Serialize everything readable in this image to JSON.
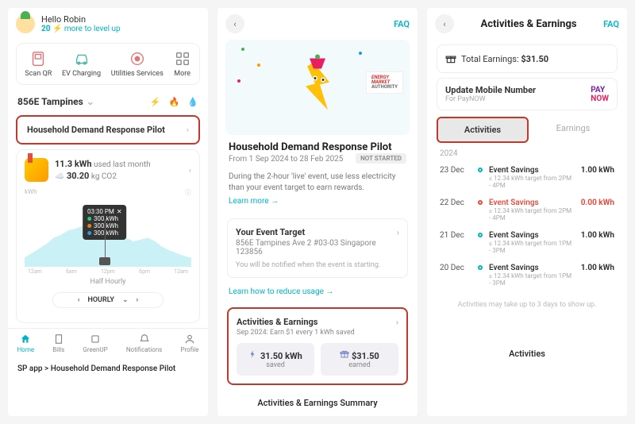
{
  "colors": {
    "accent": "#00b4c4",
    "highlight": "#c0392b"
  },
  "phone1": {
    "greeting_prefix": "Hello",
    "user_name": "Robin",
    "level_points": "20",
    "level_text": "more to level up",
    "quick": [
      {
        "id": "scan-qr",
        "label": "Scan QR"
      },
      {
        "id": "ev-charging",
        "label": "EV Charging"
      },
      {
        "id": "utilities",
        "label": "Utilities Services"
      },
      {
        "id": "more",
        "label": "More"
      }
    ],
    "address": "856E Tampines",
    "pilot_title": "Household Demand Response Pilot",
    "usage_value": "11.3 kWh",
    "usage_label": "used last month",
    "co2_value": "30.20",
    "co2_unit": "kg CO2",
    "chart": {
      "y_label": "kWh",
      "tooltip_time": "03:30 PM",
      "tooltip_items": [
        {
          "color": "#2ecc71",
          "text": "300 kWh"
        },
        {
          "color": "#e67e22",
          "text": "300 kWh"
        },
        {
          "color": "#3498db",
          "text": "300 kWh"
        }
      ],
      "x_ticks": [
        "12am",
        "6am",
        "12pm",
        "6pm",
        "12am"
      ],
      "resolution_label": "Half Hourly",
      "selector": "HOURLY"
    },
    "tabs": [
      "Home",
      "Bills",
      "GreenUP",
      "Notifications",
      "Profile"
    ],
    "caption": "SP app > Household Demand Response Pilot"
  },
  "phone2": {
    "faq": "FAQ",
    "logo_text": "ENERGY MARKET AUTHORITY",
    "title": "Household Demand Response Pilot",
    "date_range": "From 1 Sep 2024 to 28 Feb 2025",
    "status": "NOT STARTED",
    "desc": "During the 2-hour 'live' event, use less electricity than your event target to earn rewards.",
    "learn_more": "Learn more",
    "target": {
      "heading": "Your Event Target",
      "address": "856E Tampines Ave 2 #03-03 Singapore 123856",
      "note": "You will be notified when the event is starting."
    },
    "reduce_link": "Learn how to reduce usage",
    "ae": {
      "heading": "Activities & Earnings",
      "sub": "Sep 2024: Earn $1 every 1 kWh saved",
      "saved_val": "31.50 kWh",
      "saved_lbl": "saved",
      "earned_val": "$31.50",
      "earned_lbl": "earned"
    },
    "caption": "Activities & Earnings Summary"
  },
  "phone3": {
    "title": "Activities & Earnings",
    "faq": "FAQ",
    "total_label": "Total Earnings:",
    "total_value": "$31.50",
    "mobile_title": "Update Mobile Number",
    "mobile_sub": "For PayNOW",
    "tab_activities": "Activities",
    "tab_earnings": "Earnings",
    "year": "2024",
    "items": [
      {
        "date": "23 Dec",
        "title": "Event Savings",
        "sub": "≤ 12.34 kWh target from 2PM - 4PM",
        "value": "1.00 kWh",
        "red": false
      },
      {
        "date": "22 Dec",
        "title": "Event Savings",
        "sub": "≤ 12.34 kWh target from 2PM - 4PM",
        "value": "0.00 kWh",
        "red": true
      },
      {
        "date": "21 Dec",
        "title": "Event Savings",
        "sub": "≤ 12.34 kWh target from 1PM - 3PM",
        "value": "1.00 kWh",
        "red": false
      },
      {
        "date": "20 Dec",
        "title": "Event Savings",
        "sub": "≤ 12.34 kWh target from 1PM - 3PM",
        "value": "1.00 kWh",
        "red": false
      }
    ],
    "foot": "Activities may take up to 3 days to show up.",
    "caption": "Activities"
  }
}
